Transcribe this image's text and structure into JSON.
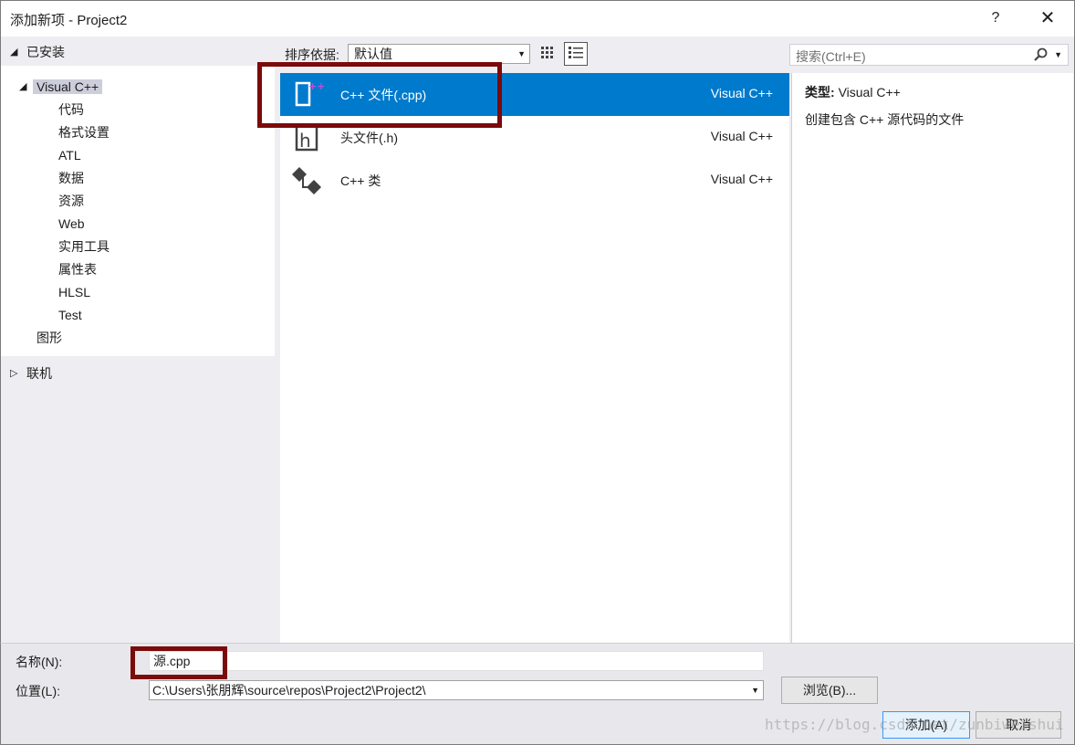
{
  "window": {
    "title": "添加新项 - Project2",
    "help_label": "?",
    "close_label": "✕"
  },
  "tree": {
    "installed_label": "已安装",
    "visual_cpp_label": "Visual C++",
    "children": [
      "代码",
      "格式设置",
      "ATL",
      "数据",
      "资源",
      "Web",
      "实用工具",
      "属性表",
      "HLSL",
      "Test"
    ],
    "graphics_label": "图形",
    "online_label": "联机"
  },
  "toolbar": {
    "sort_label": "排序依据:",
    "sort_value": "默认值",
    "view_mode": "list"
  },
  "templates": [
    {
      "name": "C++ 文件(.cpp)",
      "language": "Visual C++",
      "icon": "cpp-file-icon",
      "selected": true
    },
    {
      "name": "头文件(.h)",
      "language": "Visual C++",
      "icon": "header-file-icon",
      "selected": false
    },
    {
      "name": "C++ 类",
      "language": "Visual C++",
      "icon": "cpp-class-icon",
      "selected": false
    }
  ],
  "search": {
    "placeholder": "搜索(Ctrl+E)"
  },
  "details": {
    "type_label": "类型:",
    "type_value": "Visual C++",
    "description": "创建包含 C++ 源代码的文件"
  },
  "form": {
    "name_label": "名称(N):",
    "name_value": "源.cpp",
    "location_label": "位置(L):",
    "location_value": "C:\\Users\\张朋辉\\source\\repos\\Project2\\Project2\\",
    "browse_label": "浏览(B)...",
    "add_label": "添加(A)",
    "cancel_label": "取消"
  },
  "watermark": "https://blog.csdn.net/zunbiweishui",
  "colors": {
    "accent": "#007acc",
    "highlight_box": "#7b0a0a",
    "panel_bg": "#eeeef2",
    "tree_selection": "#cccedb"
  }
}
